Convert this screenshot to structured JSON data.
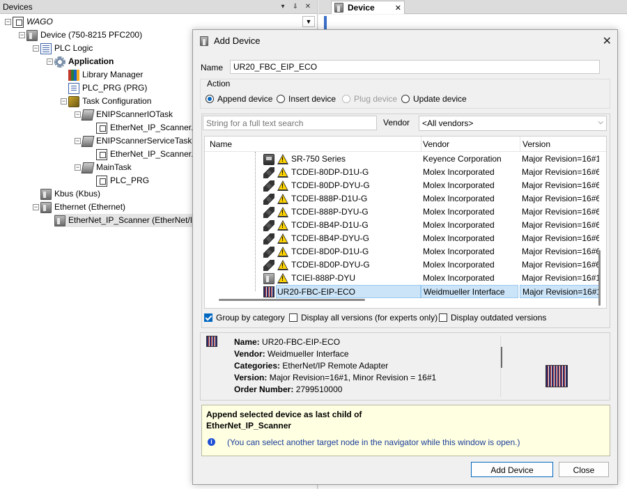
{
  "devices_panel": {
    "title": "Devices",
    "header_buttons": [
      "▾",
      "⇓",
      "✕"
    ],
    "tree": [
      {
        "label": "WAGO",
        "level": 0,
        "icon": "project-icon",
        "italic": true
      },
      {
        "label": "Device (750-8215 PFC200)",
        "level": 1,
        "icon": "device-icon"
      },
      {
        "label": "PLC Logic",
        "level": 2,
        "icon": "plc-logic-icon"
      },
      {
        "label": "Application",
        "level": 3,
        "icon": "application-gear-icon",
        "bold": true
      },
      {
        "label": "Library Manager",
        "level": 4,
        "icon": "library-icon"
      },
      {
        "label": "PLC_PRG (PRG)",
        "level": 4,
        "icon": "program-icon"
      },
      {
        "label": "Task Configuration",
        "level": 4,
        "icon": "task-config-icon"
      },
      {
        "label": "ENIPScannerIOTask",
        "level": 5,
        "icon": "task-icon"
      },
      {
        "label": "EtherNet_IP_Scanner.I",
        "level": 6,
        "icon": "task-reference-icon"
      },
      {
        "label": "ENIPScannerServiceTask",
        "level": 5,
        "icon": "task-icon"
      },
      {
        "label": "EtherNet_IP_Scanner.S",
        "level": 6,
        "icon": "task-reference-icon"
      },
      {
        "label": "MainTask",
        "level": 5,
        "icon": "task-icon"
      },
      {
        "label": "PLC_PRG",
        "level": 6,
        "icon": "task-reference-icon"
      },
      {
        "label": "Kbus (Kbus)",
        "level": 2,
        "icon": "kbus-icon"
      },
      {
        "label": "Ethernet (Ethernet)",
        "level": 2,
        "icon": "ethernet-icon"
      },
      {
        "label": "EtherNet_IP_Scanner (EtherNet/IP S",
        "level": 3,
        "icon": "scanner-icon",
        "selected": true
      }
    ]
  },
  "editor": {
    "tab_label": "Device",
    "tab_close": "✕"
  },
  "dialog": {
    "title": "Add Device",
    "close": "✕",
    "name_label": "Name",
    "name_value": "UR20_FBC_EIP_ECO",
    "action_label": "Action",
    "actions": [
      {
        "label": "Append device",
        "checked": true,
        "disabled": false
      },
      {
        "label": "Insert device",
        "checked": false,
        "disabled": false
      },
      {
        "label": "Plug device",
        "checked": false,
        "disabled": true
      },
      {
        "label": "Update device",
        "checked": false,
        "disabled": false
      }
    ],
    "search_placeholder": "String for a full text search",
    "vendor_label": "Vendor",
    "vendor_value": "<All vendors>",
    "columns": {
      "name": "Name",
      "vendor": "Vendor",
      "version": "Version"
    },
    "devices": [
      {
        "name": "SR-750 Series",
        "vendor": "Keyence Corporation",
        "version": "Major Revision=16#1",
        "icon": "keyence-module-icon",
        "warning": true
      },
      {
        "name": "TCDEI-80DP-D1U-G",
        "vendor": "Molex Incorporated",
        "version": "Major Revision=16#6",
        "icon": "connector-icon",
        "warning": true
      },
      {
        "name": "TCDEI-80DP-DYU-G",
        "vendor": "Molex Incorporated",
        "version": "Major Revision=16#6",
        "icon": "connector-icon",
        "warning": true
      },
      {
        "name": "TCDEI-888P-D1U-G",
        "vendor": "Molex Incorporated",
        "version": "Major Revision=16#6",
        "icon": "connector-icon",
        "warning": true
      },
      {
        "name": "TCDEI-888P-DYU-G",
        "vendor": "Molex Incorporated",
        "version": "Major Revision=16#6",
        "icon": "connector-icon",
        "warning": true
      },
      {
        "name": "TCDEI-8B4P-D1U-G",
        "vendor": "Molex Incorporated",
        "version": "Major Revision=16#6",
        "icon": "connector-icon",
        "warning": true
      },
      {
        "name": "TCDEI-8B4P-DYU-G",
        "vendor": "Molex Incorporated",
        "version": "Major Revision=16#6",
        "icon": "connector-icon",
        "warning": true
      },
      {
        "name": "TCDEI-8D0P-D1U-G",
        "vendor": "Molex Incorporated",
        "version": "Major Revision=16#6",
        "icon": "connector-icon",
        "warning": true
      },
      {
        "name": "TCDEI-8D0P-DYU-G",
        "vendor": "Molex Incorporated",
        "version": "Major Revision=16#6",
        "icon": "connector-icon",
        "warning": true
      },
      {
        "name": "TCIEI-888P-DYU",
        "vendor": "Molex Incorporated",
        "version": "Major Revision=16#1",
        "icon": "module-icon",
        "warning": true
      },
      {
        "name": "UR20-FBC-EIP-ECO",
        "vendor": "Weidmueller Interface",
        "version": "Major Revision=16#1",
        "icon": "ur20-icon",
        "warning": false,
        "selected": true
      }
    ],
    "options": [
      {
        "label": "Group by category",
        "checked": true
      },
      {
        "label": "Display all versions (for experts only)",
        "checked": false
      },
      {
        "label": "Display outdated versions",
        "checked": false
      }
    ],
    "info": {
      "name_key": "Name:",
      "name_val": "UR20-FBC-EIP-ECO",
      "vendor_key": "Vendor:",
      "vendor_val": "Weidmueller Interface",
      "categories_key": "Categories:",
      "categories_val": "EtherNet/IP Remote Adapter",
      "version_key": "Version:",
      "version_val": "Major Revision=16#1, Minor Revision = 16#1",
      "order_key": "Order Number:",
      "order_val": "2799510000"
    },
    "hint": {
      "line1": "Append selected device as last child of",
      "line2": "EtherNet_IP_Scanner",
      "note": "(You can select another target node in the navigator while this window is open.)"
    },
    "buttons": {
      "add": "Add Device",
      "close": "Close"
    }
  }
}
